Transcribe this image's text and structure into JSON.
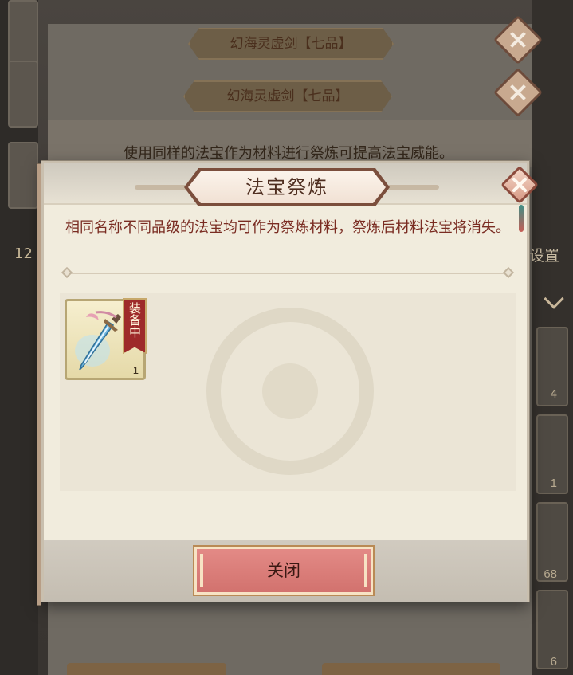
{
  "background": {
    "item_title_1": "幻海灵虚剑【七品】",
    "item_title_2": "幻海灵虚剑【七品】",
    "hint_text": "使用同样的法宝作为材料进行祭炼可提高法宝威能。",
    "left_number": "12",
    "right_label": "设置",
    "right_counts": [
      "4",
      "1",
      "68",
      "6"
    ]
  },
  "dialog": {
    "title": "法宝祭炼",
    "description": "相同名称不同品级的法宝均可作为祭炼材料，祭炼后材料法宝将消失。",
    "items": [
      {
        "icon": "sword-icon",
        "equipped_label": [
          "装",
          "备",
          "中"
        ],
        "count": "1"
      }
    ],
    "close_button_label": "关闭"
  },
  "colors": {
    "dialog_bg": "#f1ecdd",
    "title_text": "#4e2d1f",
    "description_text": "#7a2c22",
    "button_bg": "#d2726e",
    "equipped_tag": "#9e2a2a"
  }
}
